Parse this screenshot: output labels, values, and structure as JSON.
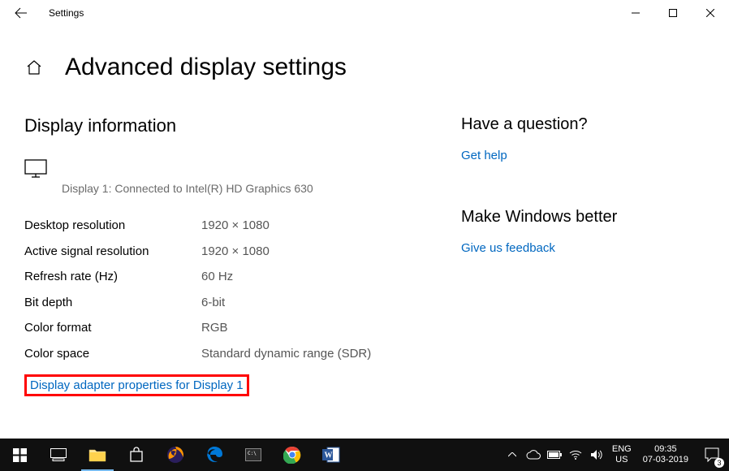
{
  "window": {
    "app_title": "Settings"
  },
  "page": {
    "title": "Advanced display settings"
  },
  "left": {
    "section_heading": "Display information",
    "connected_text": "Display 1: Connected to Intel(R) HD Graphics 630",
    "rows": [
      {
        "label": "Desktop resolution",
        "value": "1920 × 1080"
      },
      {
        "label": "Active signal resolution",
        "value": "1920 × 1080"
      },
      {
        "label": "Refresh rate (Hz)",
        "value": "60 Hz"
      },
      {
        "label": "Bit depth",
        "value": "6-bit"
      },
      {
        "label": "Color format",
        "value": "RGB"
      },
      {
        "label": "Color space",
        "value": "Standard dynamic range (SDR)"
      }
    ],
    "adapter_link": "Display adapter properties for Display 1"
  },
  "right": {
    "question_heading": "Have a question?",
    "get_help": "Get help",
    "better_heading": "Make Windows better",
    "feedback": "Give us feedback"
  },
  "taskbar": {
    "lang_top": "ENG",
    "lang_bottom": "US",
    "time": "09:35",
    "date": "07-03-2019",
    "notif_count": "3"
  }
}
